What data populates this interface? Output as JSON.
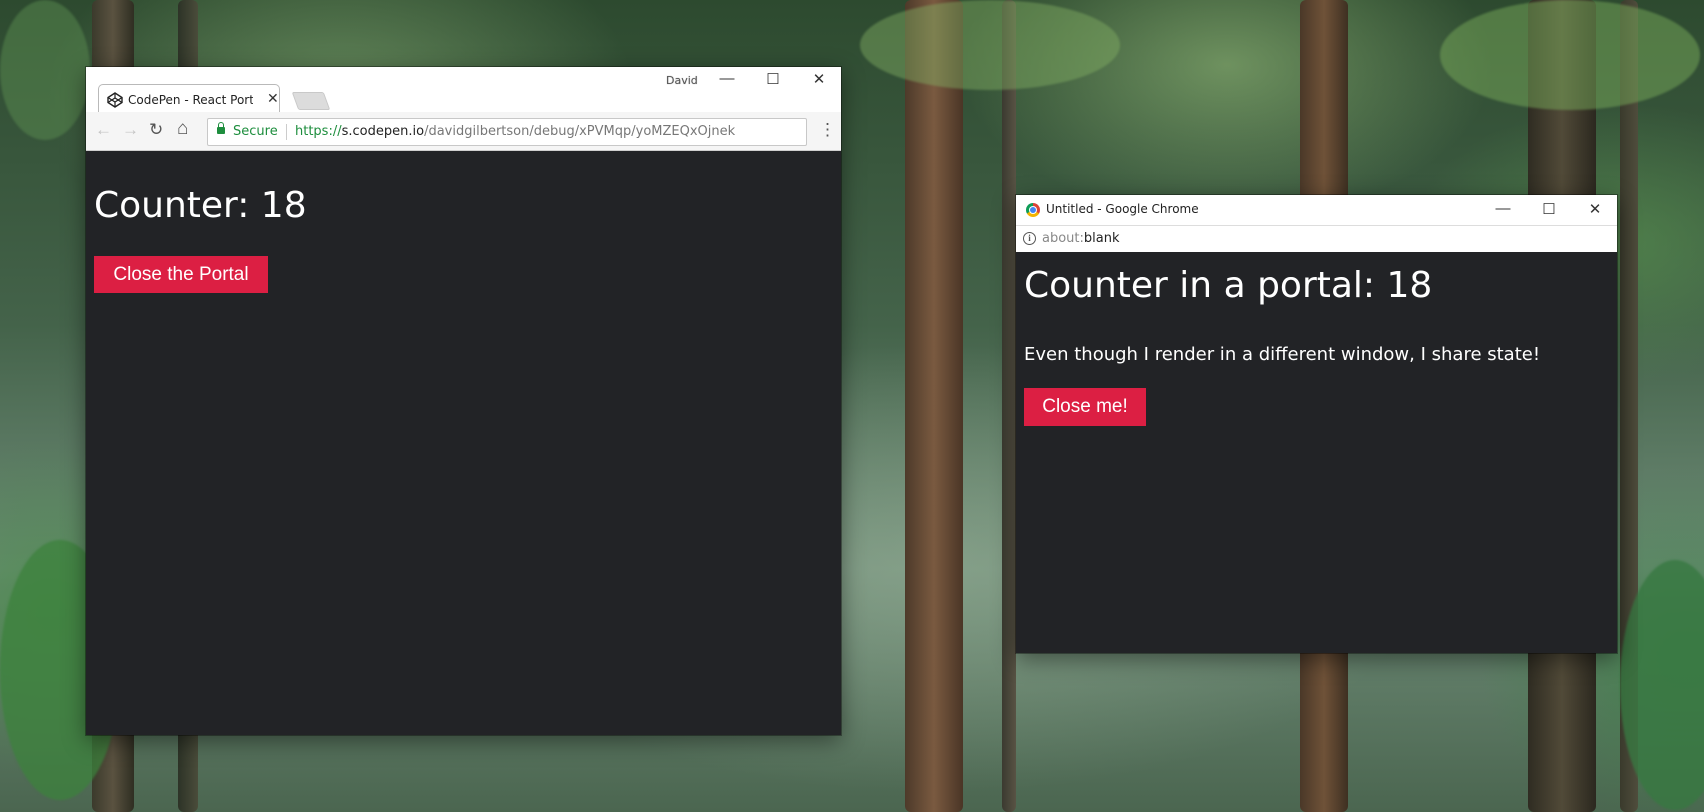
{
  "window_main": {
    "tab_title": "CodePen - React Portal C",
    "profile_name": "David",
    "controls": {
      "minimize": "—",
      "maximize": "☐",
      "close": "✕"
    },
    "toolbar": {
      "back": "←",
      "forward": "→",
      "reload": "↻",
      "home": "⌂",
      "menu": "⋮"
    },
    "address": {
      "secure_label": "Secure",
      "scheme": "https://",
      "host": "s.codepen.io",
      "path": "/davidgilbertson/debug/xPVMqp/yoMZEQxOjnek"
    },
    "page": {
      "heading": "Counter: 18",
      "button_label": "Close the Portal"
    }
  },
  "window_popup": {
    "title": "Untitled - Google Chrome",
    "controls": {
      "minimize": "—",
      "maximize": "☐",
      "close": "✕"
    },
    "address": {
      "prefix": "about:",
      "rest": "blank",
      "info_glyph": "i"
    },
    "page": {
      "heading": "Counter in a portal: 18",
      "text": "Even though I render in a different window, I share state!",
      "button_label": "Close me!"
    }
  },
  "colors": {
    "page_background": "#222326",
    "button_red": "#dc1f43",
    "secure_green": "#1e8e3e"
  }
}
